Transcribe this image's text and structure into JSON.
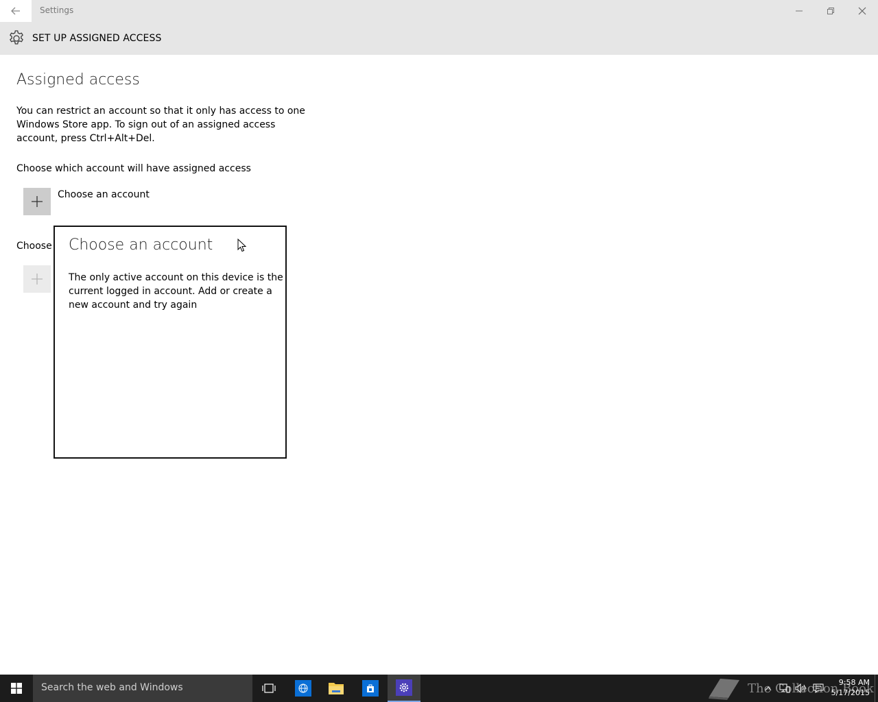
{
  "window": {
    "title": "Settings"
  },
  "header": {
    "title": "SET UP ASSIGNED ACCESS"
  },
  "main": {
    "heading": "Assigned access",
    "description": "You can restrict an account so that it only has access to one Windows Store app. To sign out of an assigned access account, press Ctrl+Alt+Del.",
    "account_section_label": "Choose which account will have assigned access",
    "account_button_label": "Choose an account",
    "app_section_label": "Choose"
  },
  "flyout": {
    "title": "Choose an account",
    "message": "The only active account on this device is the current logged in account. Add or create a new account and try again"
  },
  "taskbar": {
    "search_placeholder": "Search the web and Windows",
    "watermark": "The Collection Book",
    "time": "9:58 AM",
    "date": "5/17/2015",
    "colors": {
      "edge": "#0a6fd6",
      "store": "#0a6fd6",
      "settings": "#4b3fb8",
      "explorer": "#f2c94c"
    }
  }
}
